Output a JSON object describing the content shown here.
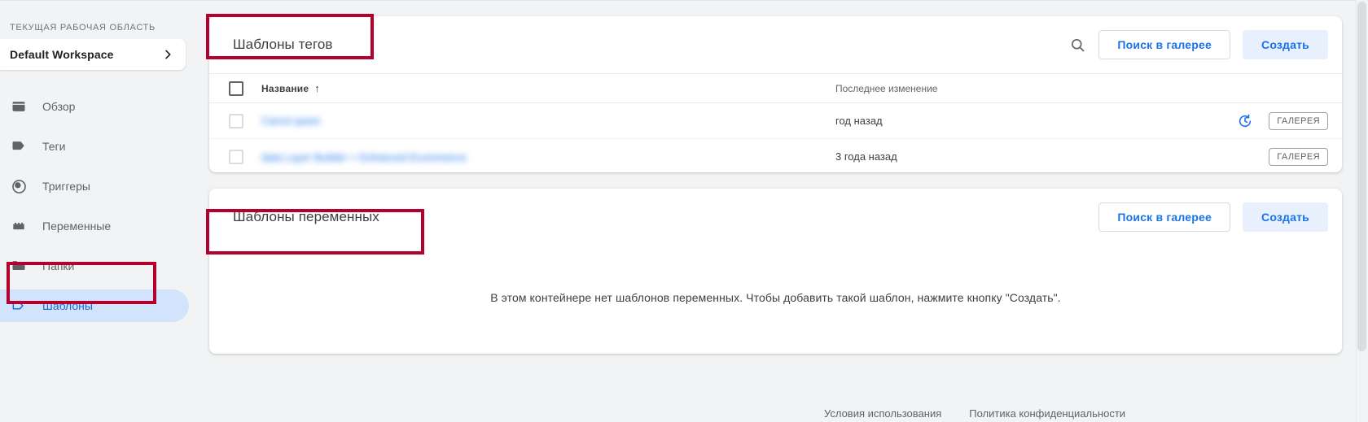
{
  "sidebar": {
    "workspace_label": "ТЕКУЩАЯ РАБОЧАЯ ОБЛАСТЬ",
    "workspace_name": "Default Workspace",
    "chevron_icon": "chevron-right-icon",
    "items": [
      {
        "label": "Обзор",
        "icon": "overview-icon",
        "selected": false
      },
      {
        "label": "Теги",
        "icon": "tag-icon",
        "selected": false
      },
      {
        "label": "Триггеры",
        "icon": "trigger-icon",
        "selected": false
      },
      {
        "label": "Переменные",
        "icon": "variables-icon",
        "selected": false
      },
      {
        "label": "Папки",
        "icon": "folder-icon",
        "selected": false
      },
      {
        "label": "Шаблоны",
        "icon": "template-icon",
        "selected": true
      }
    ]
  },
  "tag_templates": {
    "title": "Шаблоны тегов",
    "search_icon": "search-icon",
    "gallery_button": "Поиск в галерее",
    "create_button": "Создать",
    "columns": {
      "name": "Название",
      "sort_arrow": "↑",
      "last_modified": "Последнее изменение"
    },
    "rows": [
      {
        "name": "",
        "redacted": true,
        "last_modified": "год назад",
        "has_update": true,
        "badge": "ГАЛЕРЕЯ"
      },
      {
        "name": "",
        "redacted": true,
        "last_modified": "3 года назад",
        "has_update": false,
        "badge": "ГАЛЕРЕЯ"
      }
    ]
  },
  "variable_templates": {
    "title": "Шаблоны переменных",
    "gallery_button": "Поиск в галерее",
    "create_button": "Создать",
    "empty_message": "В этом контейнере нет шаблонов переменных. Чтобы добавить такой шаблон, нажмите кнопку \"Создать\"."
  },
  "footer": {
    "terms": "Условия использования",
    "privacy": "Политика конфиденциальности"
  },
  "colors": {
    "accent_blue": "#1a73e8",
    "selected_bg": "#d2e3fc",
    "tonal_button_bg": "#e8f0fe",
    "page_bg": "#f1f3f4",
    "annotation_red": "#b3002d"
  }
}
